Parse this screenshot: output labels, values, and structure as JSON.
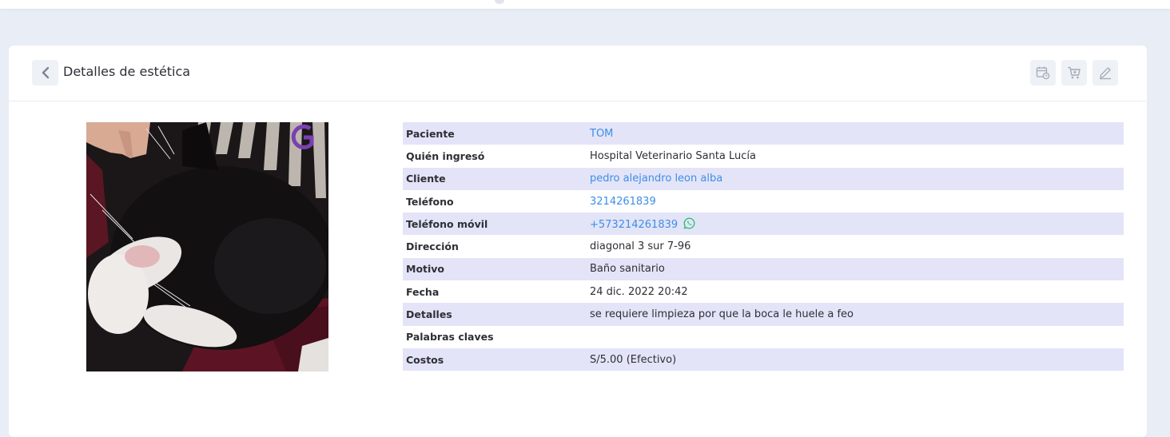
{
  "header": {
    "title": "Detalles de estética"
  },
  "actions": [
    {
      "icon": "calendar-clock-icon"
    },
    {
      "icon": "shopping-cart-icon"
    },
    {
      "icon": "pencil-edit-icon"
    }
  ],
  "photo": {
    "subject": "cat-photo"
  },
  "details": {
    "paciente": {
      "label": "Paciente",
      "value": "TOM"
    },
    "quien": {
      "label": "Quién ingresó",
      "value": "Hospital Veterinario Santa Lucía"
    },
    "cliente": {
      "label": "Cliente",
      "value": "pedro alejandro leon alba"
    },
    "telefono": {
      "label": "Teléfono",
      "value": "3214261839"
    },
    "movil": {
      "label": "Teléfono móvil",
      "value": "+573214261839"
    },
    "direccion": {
      "label": "Dirección",
      "value": "diagonal 3 sur 7-96"
    },
    "motivo": {
      "label": "Motivo",
      "value": "Baño sanitario"
    },
    "fecha": {
      "label": "Fecha",
      "value": "24 dic. 2022 20:42"
    },
    "detalles": {
      "label": "Detalles",
      "value": "se requiere limpieza por que la boca le huele a feo"
    },
    "palabras": {
      "label": "Palabras claves",
      "value": ""
    },
    "costos": {
      "label": "Costos",
      "value": "S/5.00 (Efectivo)"
    }
  },
  "colors": {
    "link": "#3d8fe6",
    "row_stripe": "#e3e4f8",
    "whatsapp": "#25c26e"
  }
}
